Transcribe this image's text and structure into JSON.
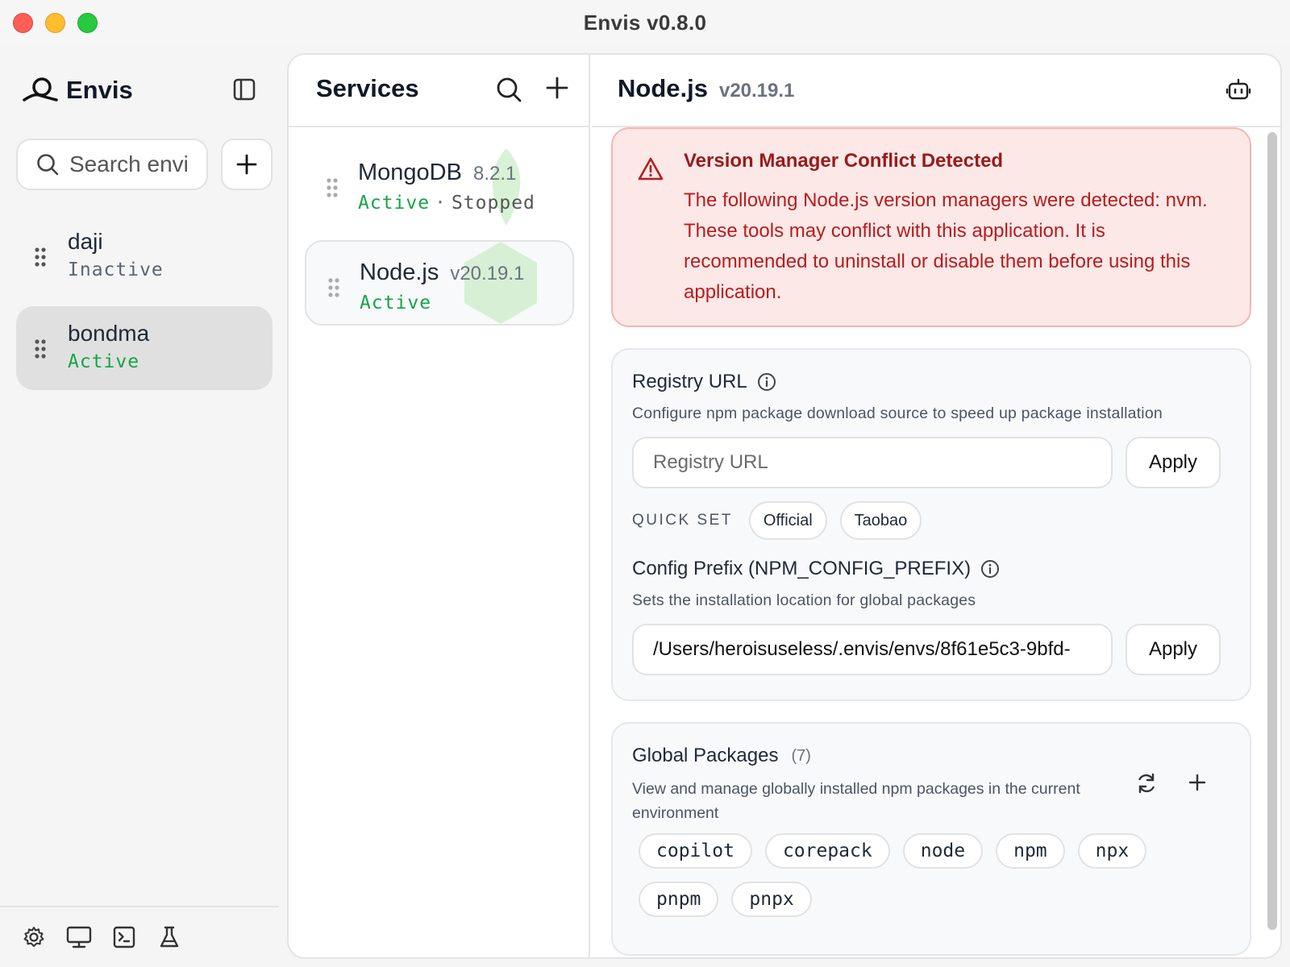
{
  "window": {
    "title": "Envis  v0.8.0"
  },
  "sidebar": {
    "brand": "Envis",
    "search_placeholder": "Search envi",
    "environments": [
      {
        "name": "daji",
        "status": "Inactive"
      },
      {
        "name": "bondma",
        "status": "Active"
      }
    ]
  },
  "services": {
    "title": "Services",
    "items": [
      {
        "name": "MongoDB",
        "version": "8.2.1",
        "status": "Active",
        "state": "Stopped"
      },
      {
        "name": "Node.js",
        "version": "v20.19.1",
        "status": "Active"
      }
    ]
  },
  "detail": {
    "name": "Node.js",
    "version": "v20.19.1",
    "alert": {
      "title": "Version Manager Conflict Detected",
      "body": "The following Node.js version managers were detected: nvm. These tools may conflict with this application. It is recommended to uninstall or disable them before using this application."
    },
    "registry": {
      "label": "Registry URL",
      "description": "Configure npm package download source to speed up package installation",
      "placeholder": "Registry URL",
      "value": "",
      "apply_label": "Apply",
      "quick_set_label": "QUICK SET",
      "quick_options": [
        "Official",
        "Taobao"
      ]
    },
    "prefix": {
      "label": "Config Prefix (NPM_CONFIG_PREFIX)",
      "description": "Sets the installation location for global packages",
      "value": "/Users/heroisuseless/.envis/envs/8f61e5c3-9bfd-",
      "apply_label": "Apply"
    },
    "packages": {
      "title": "Global Packages",
      "count": "(7)",
      "description": "View and manage globally installed npm packages in the current environment",
      "items": [
        "copilot",
        "corepack",
        "node",
        "npm",
        "npx",
        "pnpm",
        "pnpx"
      ]
    }
  },
  "icons": {
    "brand": "envis-logo-icon",
    "collapse": "sidebar-toggle-icon",
    "search": "search-icon",
    "add": "plus-icon",
    "grip": "drag-handle-icon",
    "robot": "robot-icon",
    "warning": "warning-triangle-icon",
    "info": "info-icon",
    "refresh": "refresh-icon",
    "footer": [
      "gear-icon",
      "monitor-icon",
      "terminal-icon",
      "flask-icon"
    ]
  },
  "colors": {
    "active": "#16a34a",
    "alert_bg": "#fde8e8",
    "alert_text": "#b91c1c",
    "selected_env_bg": "#e0e0e0"
  }
}
